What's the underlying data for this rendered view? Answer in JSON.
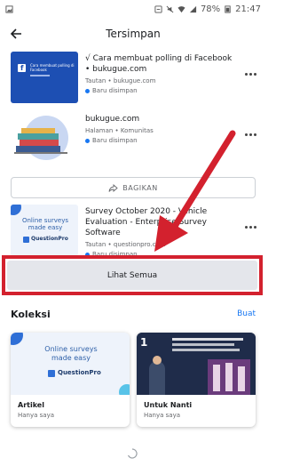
{
  "status_bar": {
    "battery": "78%",
    "time": "21:47"
  },
  "header": {
    "title": "Tersimpan"
  },
  "saved_items": [
    {
      "title": "√ Cara membuat polling di Facebook • bukugue.com",
      "meta": "Tautan • bukugue.com",
      "status": "Baru disimpan",
      "thumb_caption": "Cara membuat polling di Facebook"
    },
    {
      "title": "bukugue.com",
      "meta": "Halaman • Komunitas",
      "status": "Baru disimpan"
    },
    {
      "title": "Survey October 2020 - Vehicle Evaluation - Enterprise Survey Software",
      "meta": "Tautan • questionpro.com",
      "status": "Baru disimpan",
      "thumb_caption": "Online surveys made easy",
      "thumb_brand": "QuestionPro"
    }
  ],
  "share_label": "BAGIKAN",
  "see_all_label": "Lihat Semua",
  "collections": {
    "title": "Koleksi",
    "create_label": "Buat",
    "items": [
      {
        "name": "Artikel",
        "privacy": "Hanya saya",
        "thumb_caption": "Online surveys made easy",
        "thumb_brand": "QuestionPro"
      },
      {
        "name": "Untuk Nanti",
        "privacy": "Hanya saya"
      }
    ]
  },
  "colors": {
    "accent": "#1877f2",
    "annotation": "#d3212e"
  },
  "icons": [
    "back-arrow-icon",
    "share-icon",
    "more-options-icon",
    "loading-spinner-icon"
  ]
}
